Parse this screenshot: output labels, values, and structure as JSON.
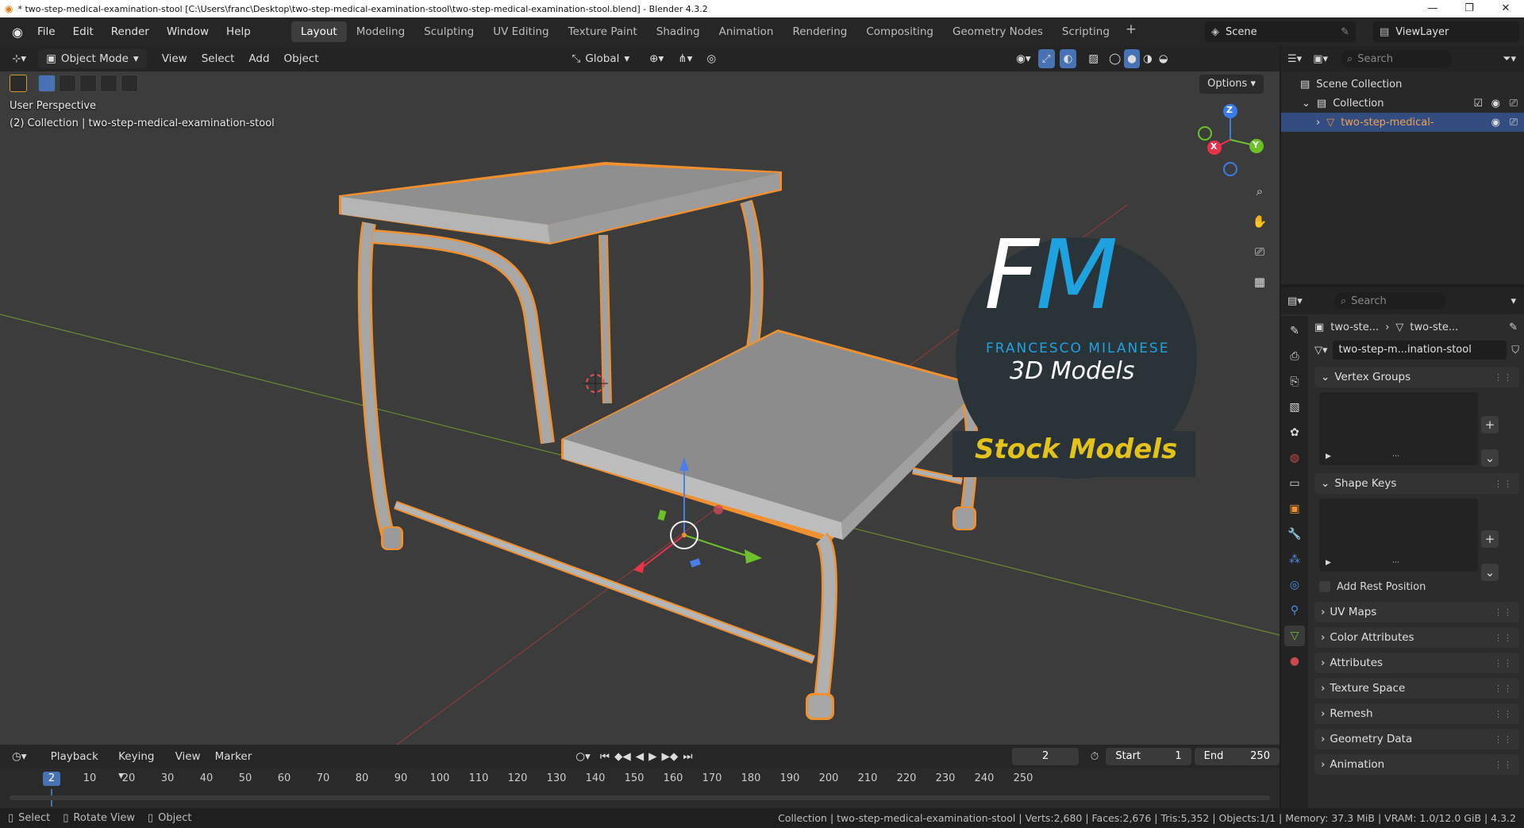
{
  "window": {
    "title": "* two-step-medical-examination-stool [C:\\Users\\franc\\Desktop\\two-step-medical-examination-stool\\two-step-medical-examination-stool.blend] - Blender 4.3.2",
    "minimize": "—",
    "maximize": "❐",
    "close": "✕"
  },
  "menu": [
    "File",
    "Edit",
    "Render",
    "Window",
    "Help"
  ],
  "workspaces": [
    "Layout",
    "Modeling",
    "Sculpting",
    "UV Editing",
    "Texture Paint",
    "Shading",
    "Animation",
    "Rendering",
    "Compositing",
    "Geometry Nodes",
    "Scripting"
  ],
  "scene": "Scene",
  "view_layer": "ViewLayer",
  "viewport": {
    "mode": "Object Mode",
    "menus": [
      "View",
      "Select",
      "Add",
      "Object"
    ],
    "transform_orientation": "Global",
    "options": "Options",
    "perspective": "User Perspective",
    "collection_info": "(2) Collection | two-step-medical-examination-stool",
    "watermark": {
      "letters_f": "F",
      "letters_m": "M",
      "name": "FRANCESCO MILANESE",
      "sub": "3D Models",
      "banner": "Stock Models"
    },
    "gizmo": {
      "x": "X",
      "y": "Y",
      "z": "Z"
    }
  },
  "timeline": {
    "menus": [
      "Playback",
      "Keying",
      "View",
      "Marker"
    ],
    "current_frame": "2",
    "start_label": "Start",
    "start": "1",
    "end_label": "End",
    "end": "250",
    "ruler": [
      "10",
      "20",
      "30",
      "40",
      "50",
      "60",
      "70",
      "80",
      "90",
      "100",
      "110",
      "120",
      "130",
      "140",
      "150",
      "160",
      "170",
      "180",
      "190",
      "200",
      "210",
      "220",
      "230",
      "240",
      "250"
    ]
  },
  "statusbar": {
    "select": "Select",
    "rotate": "Rotate View",
    "object": "Object",
    "stats": "Collection | two-step-medical-examination-stool | Verts:2,680 | Faces:2,676 | Tris:5,352 | Objects:1/1 | Memory: 37.3 MiB | VRAM: 1.0/12.0 GiB | 4.3.2"
  },
  "outliner": {
    "search_placeholder": "Search",
    "scene_collection": "Scene Collection",
    "collection": "Collection",
    "object": "two-step-medical-"
  },
  "properties": {
    "search_placeholder": "Search",
    "breadcrumb_obj": "two-ste...",
    "breadcrumb_mesh": "two-ste...",
    "mesh_name": "two-step-m...ination-stool",
    "panels": {
      "vertex_groups": "Vertex Groups",
      "shape_keys": "Shape Keys",
      "add_rest_position": "Add Rest Position",
      "uv_maps": "UV Maps",
      "color_attributes": "Color Attributes",
      "attributes": "Attributes",
      "texture_space": "Texture Space",
      "remesh": "Remesh",
      "geometry_data": "Geometry Data",
      "animation": "Animation"
    }
  },
  "colors": {
    "accent_blue": "#4772b3",
    "selection_orange": "#f0902f",
    "fm_blue": "#1fa3e0",
    "stock_yellow": "#e3c21a"
  }
}
